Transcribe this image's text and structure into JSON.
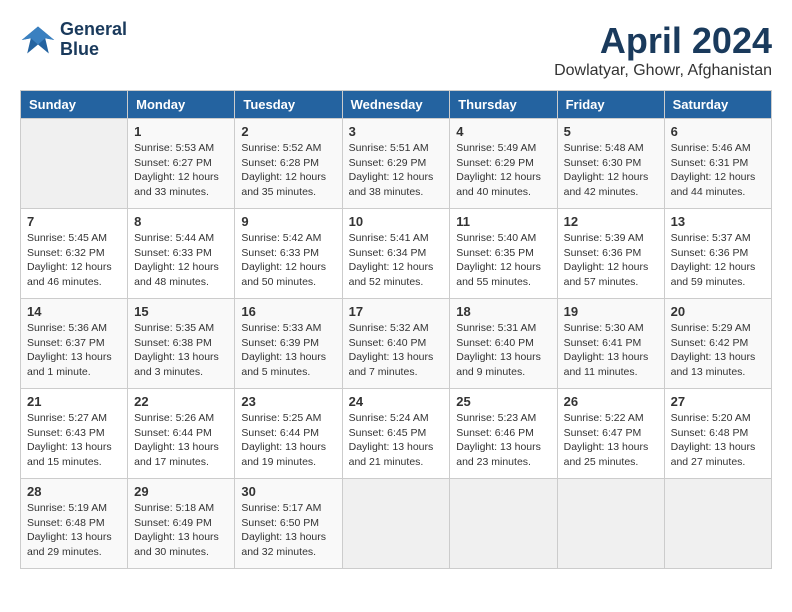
{
  "header": {
    "logo_line1": "General",
    "logo_line2": "Blue",
    "title": "April 2024",
    "subtitle": "Dowlatyar, Ghowr, Afghanistan"
  },
  "columns": [
    "Sunday",
    "Monday",
    "Tuesday",
    "Wednesday",
    "Thursday",
    "Friday",
    "Saturday"
  ],
  "weeks": [
    [
      {
        "day": "",
        "info": ""
      },
      {
        "day": "1",
        "info": "Sunrise: 5:53 AM\nSunset: 6:27 PM\nDaylight: 12 hours\nand 33 minutes."
      },
      {
        "day": "2",
        "info": "Sunrise: 5:52 AM\nSunset: 6:28 PM\nDaylight: 12 hours\nand 35 minutes."
      },
      {
        "day": "3",
        "info": "Sunrise: 5:51 AM\nSunset: 6:29 PM\nDaylight: 12 hours\nand 38 minutes."
      },
      {
        "day": "4",
        "info": "Sunrise: 5:49 AM\nSunset: 6:29 PM\nDaylight: 12 hours\nand 40 minutes."
      },
      {
        "day": "5",
        "info": "Sunrise: 5:48 AM\nSunset: 6:30 PM\nDaylight: 12 hours\nand 42 minutes."
      },
      {
        "day": "6",
        "info": "Sunrise: 5:46 AM\nSunset: 6:31 PM\nDaylight: 12 hours\nand 44 minutes."
      }
    ],
    [
      {
        "day": "7",
        "info": "Sunrise: 5:45 AM\nSunset: 6:32 PM\nDaylight: 12 hours\nand 46 minutes."
      },
      {
        "day": "8",
        "info": "Sunrise: 5:44 AM\nSunset: 6:33 PM\nDaylight: 12 hours\nand 48 minutes."
      },
      {
        "day": "9",
        "info": "Sunrise: 5:42 AM\nSunset: 6:33 PM\nDaylight: 12 hours\nand 50 minutes."
      },
      {
        "day": "10",
        "info": "Sunrise: 5:41 AM\nSunset: 6:34 PM\nDaylight: 12 hours\nand 52 minutes."
      },
      {
        "day": "11",
        "info": "Sunrise: 5:40 AM\nSunset: 6:35 PM\nDaylight: 12 hours\nand 55 minutes."
      },
      {
        "day": "12",
        "info": "Sunrise: 5:39 AM\nSunset: 6:36 PM\nDaylight: 12 hours\nand 57 minutes."
      },
      {
        "day": "13",
        "info": "Sunrise: 5:37 AM\nSunset: 6:36 PM\nDaylight: 12 hours\nand 59 minutes."
      }
    ],
    [
      {
        "day": "14",
        "info": "Sunrise: 5:36 AM\nSunset: 6:37 PM\nDaylight: 13 hours\nand 1 minute."
      },
      {
        "day": "15",
        "info": "Sunrise: 5:35 AM\nSunset: 6:38 PM\nDaylight: 13 hours\nand 3 minutes."
      },
      {
        "day": "16",
        "info": "Sunrise: 5:33 AM\nSunset: 6:39 PM\nDaylight: 13 hours\nand 5 minutes."
      },
      {
        "day": "17",
        "info": "Sunrise: 5:32 AM\nSunset: 6:40 PM\nDaylight: 13 hours\nand 7 minutes."
      },
      {
        "day": "18",
        "info": "Sunrise: 5:31 AM\nSunset: 6:40 PM\nDaylight: 13 hours\nand 9 minutes."
      },
      {
        "day": "19",
        "info": "Sunrise: 5:30 AM\nSunset: 6:41 PM\nDaylight: 13 hours\nand 11 minutes."
      },
      {
        "day": "20",
        "info": "Sunrise: 5:29 AM\nSunset: 6:42 PM\nDaylight: 13 hours\nand 13 minutes."
      }
    ],
    [
      {
        "day": "21",
        "info": "Sunrise: 5:27 AM\nSunset: 6:43 PM\nDaylight: 13 hours\nand 15 minutes."
      },
      {
        "day": "22",
        "info": "Sunrise: 5:26 AM\nSunset: 6:44 PM\nDaylight: 13 hours\nand 17 minutes."
      },
      {
        "day": "23",
        "info": "Sunrise: 5:25 AM\nSunset: 6:44 PM\nDaylight: 13 hours\nand 19 minutes."
      },
      {
        "day": "24",
        "info": "Sunrise: 5:24 AM\nSunset: 6:45 PM\nDaylight: 13 hours\nand 21 minutes."
      },
      {
        "day": "25",
        "info": "Sunrise: 5:23 AM\nSunset: 6:46 PM\nDaylight: 13 hours\nand 23 minutes."
      },
      {
        "day": "26",
        "info": "Sunrise: 5:22 AM\nSunset: 6:47 PM\nDaylight: 13 hours\nand 25 minutes."
      },
      {
        "day": "27",
        "info": "Sunrise: 5:20 AM\nSunset: 6:48 PM\nDaylight: 13 hours\nand 27 minutes."
      }
    ],
    [
      {
        "day": "28",
        "info": "Sunrise: 5:19 AM\nSunset: 6:48 PM\nDaylight: 13 hours\nand 29 minutes."
      },
      {
        "day": "29",
        "info": "Sunrise: 5:18 AM\nSunset: 6:49 PM\nDaylight: 13 hours\nand 30 minutes."
      },
      {
        "day": "30",
        "info": "Sunrise: 5:17 AM\nSunset: 6:50 PM\nDaylight: 13 hours\nand 32 minutes."
      },
      {
        "day": "",
        "info": ""
      },
      {
        "day": "",
        "info": ""
      },
      {
        "day": "",
        "info": ""
      },
      {
        "day": "",
        "info": ""
      }
    ]
  ]
}
